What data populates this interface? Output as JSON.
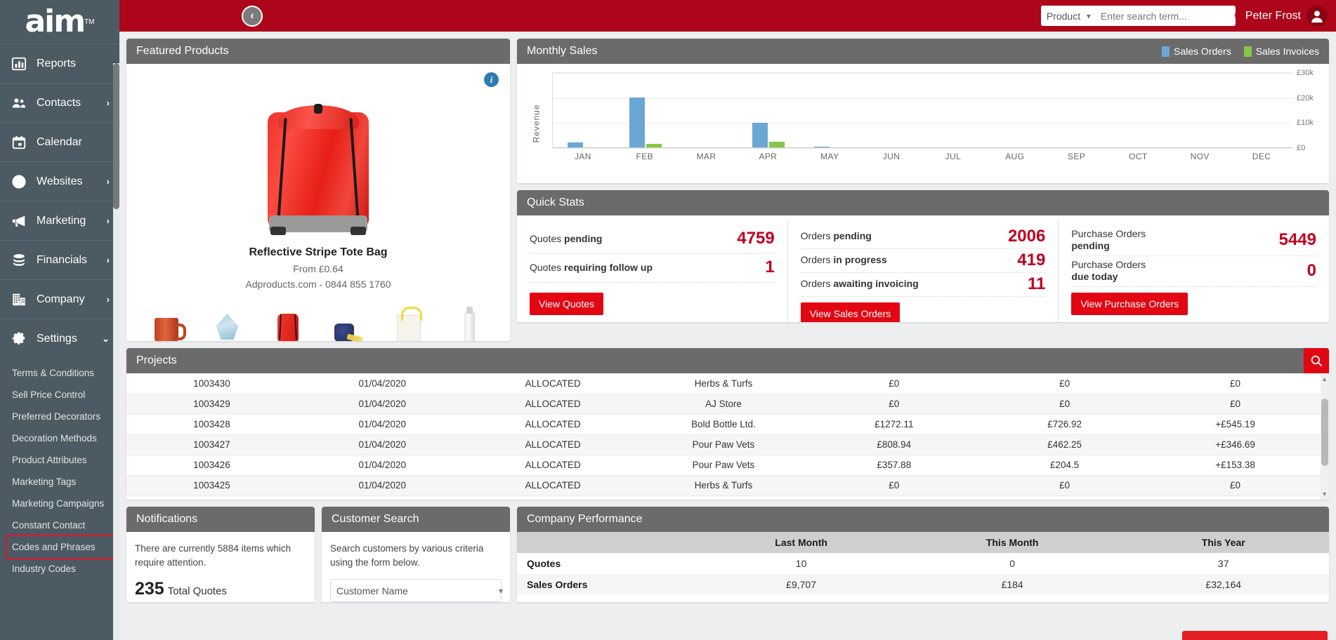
{
  "brand": {
    "logo": "aim",
    "tm": "TM",
    "accent": "#ad0519",
    "button_red": "#e20613"
  },
  "topbar": {
    "search_scope": "Product",
    "search_placeholder": "Enter search term...",
    "user_name": "Peter Frost"
  },
  "collapse_button": {
    "glyph": "‹"
  },
  "sidebar": {
    "items": [
      {
        "label": "Reports",
        "icon": "chart-bar-icon",
        "arrow": ""
      },
      {
        "label": "Contacts",
        "icon": "contacts-icon",
        "arrow": "›"
      },
      {
        "label": "Calendar",
        "icon": "calendar-icon",
        "arrow": ""
      },
      {
        "label": "Websites",
        "icon": "globe-icon",
        "arrow": "›"
      },
      {
        "label": "Marketing",
        "icon": "megaphone-icon",
        "arrow": "›"
      },
      {
        "label": "Financials",
        "icon": "coins-icon",
        "arrow": "›"
      },
      {
        "label": "Company",
        "icon": "building-icon",
        "arrow": "›"
      },
      {
        "label": "Settings",
        "icon": "gear-icon",
        "arrow": "⌄"
      }
    ],
    "sub_items": [
      {
        "label": "Terms & Conditions",
        "highlighted": false
      },
      {
        "label": "Sell Price Control",
        "highlighted": false
      },
      {
        "label": "Preferred Decorators",
        "highlighted": false
      },
      {
        "label": "Decoration Methods",
        "highlighted": false
      },
      {
        "label": "Product Attributes",
        "highlighted": false
      },
      {
        "label": "Marketing Tags",
        "highlighted": false
      },
      {
        "label": "Marketing Campaigns",
        "highlighted": false
      },
      {
        "label": "Constant Contact",
        "highlighted": false
      },
      {
        "label": "Codes and Phrases",
        "highlighted": true
      },
      {
        "label": "Industry Codes",
        "highlighted": false
      }
    ]
  },
  "featured": {
    "title": "Featured Products",
    "info_glyph": "i",
    "product_name": "Reflective Stripe Tote Bag",
    "price": "From £0.64",
    "supplier": "Adproducts.com - 0844 855 1760",
    "thumbs": [
      {
        "name": "mug",
        "selected": false
      },
      {
        "name": "award",
        "selected": false
      },
      {
        "name": "drawstring-bag",
        "selected": true
      },
      {
        "name": "tape-measure",
        "selected": false
      },
      {
        "name": "tote-bag",
        "selected": false
      },
      {
        "name": "bottle",
        "selected": false
      }
    ]
  },
  "monthly_sales": {
    "title": "Monthly Sales",
    "legend": [
      {
        "label": "Sales Orders",
        "color": "#6ba7d4"
      },
      {
        "label": "Sales Invoices",
        "color": "#84c846"
      }
    ]
  },
  "chart_data": {
    "type": "bar",
    "title": "Monthly Sales",
    "xlabel": "",
    "ylabel": "Revenue",
    "ylim": [
      0,
      30000
    ],
    "ytick_labels": [
      "£30k",
      "£20k",
      "£10k",
      "£0"
    ],
    "ytick_values": [
      30000,
      20000,
      10000,
      0
    ],
    "grid": true,
    "legend_position": "top-right",
    "categories": [
      "JAN",
      "FEB",
      "MAR",
      "APR",
      "MAY",
      "JUN",
      "JUL",
      "AUG",
      "SEP",
      "OCT",
      "NOV",
      "DEC"
    ],
    "series": [
      {
        "name": "Sales Orders",
        "color": "#6ba7d4",
        "values": [
          2000,
          20000,
          0,
          10000,
          300,
          0,
          0,
          0,
          0,
          0,
          0,
          0
        ]
      },
      {
        "name": "Sales Invoices",
        "color": "#84c846",
        "values": [
          0,
          1300,
          0,
          2400,
          0,
          0,
          0,
          0,
          0,
          0,
          0,
          0
        ]
      }
    ]
  },
  "quick_stats": {
    "title": "Quick Stats",
    "columns": [
      {
        "rows": [
          {
            "label_plain": "Quotes ",
            "label_bold": "pending",
            "value": "4759"
          },
          {
            "label_plain": "Quotes ",
            "label_bold": "requiring follow up",
            "value": "1"
          }
        ],
        "button": "View Quotes"
      },
      {
        "rows": [
          {
            "label_plain": "Orders ",
            "label_bold": "pending",
            "value": "2006"
          },
          {
            "label_plain": "Orders ",
            "label_bold": "in progress",
            "value": "419"
          },
          {
            "label_plain": "Orders ",
            "label_bold": "awaiting invoicing",
            "value": "11"
          }
        ],
        "button": "View Sales Orders"
      },
      {
        "rows": [
          {
            "label_plain": "Purchase Orders ",
            "label_bold": "pending",
            "value": "5449"
          },
          {
            "label_plain": "Purchase Orders ",
            "label_bold": "due today",
            "value": "0"
          }
        ],
        "button": "View Purchase Orders"
      }
    ]
  },
  "projects": {
    "title": "Projects",
    "search_icon": "search-icon",
    "rows": [
      {
        "id": "1003430",
        "date": "01/04/2020",
        "status": "ALLOCATED",
        "customer": "Herbs & Turfs",
        "value": "£0",
        "cost": "£0",
        "margin": "£0",
        "margin_positive": false
      },
      {
        "id": "1003429",
        "date": "01/04/2020",
        "status": "ALLOCATED",
        "customer": "AJ Store",
        "value": "£0",
        "cost": "£0",
        "margin": "£0",
        "margin_positive": false
      },
      {
        "id": "1003428",
        "date": "01/04/2020",
        "status": "ALLOCATED",
        "customer": "Bold Bottle Ltd.",
        "value": "£1272.11",
        "cost": "£726.92",
        "margin": "+£545.19",
        "margin_positive": true
      },
      {
        "id": "1003427",
        "date": "01/04/2020",
        "status": "ALLOCATED",
        "customer": "Pour Paw Vets",
        "value": "£808.94",
        "cost": "£462.25",
        "margin": "+£346.69",
        "margin_positive": true
      },
      {
        "id": "1003426",
        "date": "01/04/2020",
        "status": "ALLOCATED",
        "customer": "Pour Paw Vets",
        "value": "£357.88",
        "cost": "£204.5",
        "margin": "+£153.38",
        "margin_positive": true
      },
      {
        "id": "1003425",
        "date": "01/04/2020",
        "status": "ALLOCATED",
        "customer": "Herbs & Turfs",
        "value": "£0",
        "cost": "£0",
        "margin": "£0",
        "margin_positive": false
      }
    ]
  },
  "notifications": {
    "title": "Notifications",
    "message": "There are currently 5884 items which require attention.",
    "count": "235",
    "count_label": "Total Quotes"
  },
  "customer_search": {
    "title": "Customer Search",
    "message": "Search customers by various criteria using the form below.",
    "selected_option": "Customer Name"
  },
  "company_performance": {
    "title": "Company Performance",
    "headers": [
      "",
      "Last Month",
      "This Month",
      "This Year"
    ],
    "rows": [
      {
        "label": "Quotes",
        "last_month": "10",
        "this_month": "0",
        "this_year": "37"
      },
      {
        "label": "Sales Orders",
        "last_month": "£9,707",
        "this_month": "£184",
        "this_year": "£32,164"
      }
    ]
  }
}
